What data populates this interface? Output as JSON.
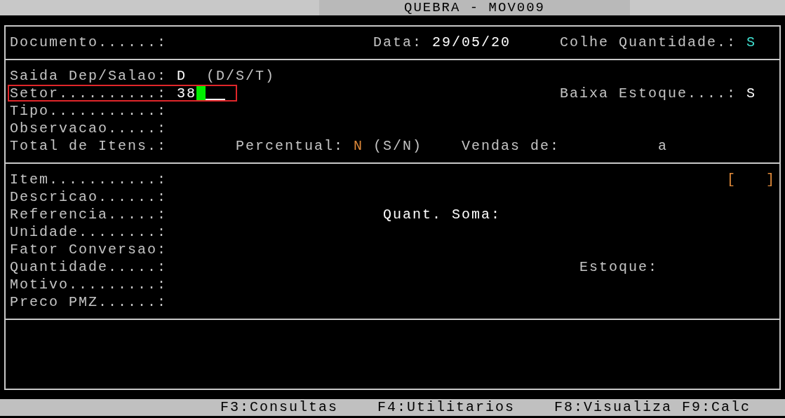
{
  "window": {
    "title": "QUEBRA - MOV009"
  },
  "sections": [
    {
      "lines": [
        {
          "outlined": false,
          "items": [
            {
              "kind": "label",
              "text": "Documento......:"
            },
            {
              "kind": "label",
              "text": "Data:"
            },
            {
              "kind": "value",
              "text": "29/05/20"
            },
            {
              "kind": "label",
              "text": "Colhe Quantidade.:"
            },
            {
              "kind": "accent",
              "text": "S"
            }
          ]
        }
      ]
    },
    {
      "lines": [
        {
          "outlined": false,
          "items": [
            {
              "kind": "label",
              "text": "Saida Dep/Salao:"
            },
            {
              "kind": "value",
              "text": "D"
            },
            {
              "kind": "label",
              "text": "(D/S/T)"
            }
          ]
        },
        {
          "outlined": true,
          "items": [
            {
              "kind": "label",
              "text": "Setor..........:"
            },
            {
              "kind": "field",
              "text": "38"
            },
            {
              "kind": "label",
              "text": "Baixa Estoque....:"
            },
            {
              "kind": "value",
              "text": "S"
            }
          ]
        },
        {
          "outlined": false,
          "items": [
            {
              "kind": "label",
              "text": "Tipo...........:"
            }
          ]
        },
        {
          "outlined": false,
          "items": [
            {
              "kind": "label",
              "text": "Observacao.....:"
            }
          ]
        },
        {
          "outlined": false,
          "items": [
            {
              "kind": "label",
              "text": "Total de Itens.:"
            },
            {
              "kind": "label",
              "text": "Percentual:"
            },
            {
              "kind": "option",
              "text": "N"
            },
            {
              "kind": "label",
              "text": "(S/N)"
            },
            {
              "kind": "label",
              "text": "Vendas de:"
            },
            {
              "kind": "label",
              "text": "a"
            }
          ]
        }
      ]
    },
    {
      "lines": [
        {
          "outlined": false,
          "items": [
            {
              "kind": "label",
              "text": "Item...........:"
            },
            {
              "kind": "option",
              "text": "[   ]"
            }
          ]
        },
        {
          "outlined": false,
          "items": [
            {
              "kind": "label",
              "text": "Descricao......:"
            }
          ]
        },
        {
          "outlined": false,
          "items": [
            {
              "kind": "label",
              "text": "Referencia.....:"
            },
            {
              "kind": "value",
              "text": "Quant. Soma:"
            }
          ]
        },
        {
          "outlined": false,
          "items": [
            {
              "kind": "label",
              "text": "Unidade........:"
            }
          ]
        },
        {
          "outlined": false,
          "items": [
            {
              "kind": "label",
              "text": "Fator Conversao:"
            }
          ]
        },
        {
          "outlined": false,
          "items": [
            {
              "kind": "label",
              "text": "Quantidade.....:"
            },
            {
              "kind": "label",
              "text": "Estoque:"
            }
          ]
        },
        {
          "outlined": false,
          "items": [
            {
              "kind": "label",
              "text": "Motivo.........:"
            }
          ]
        },
        {
          "outlined": false,
          "items": [
            {
              "kind": "label",
              "text": "Preco PMZ......:"
            }
          ]
        }
      ]
    }
  ],
  "function_keys": [
    "F3:Consultas",
    "F4:Utilitarios",
    "F8:Visualiza",
    "F9:Calc"
  ]
}
